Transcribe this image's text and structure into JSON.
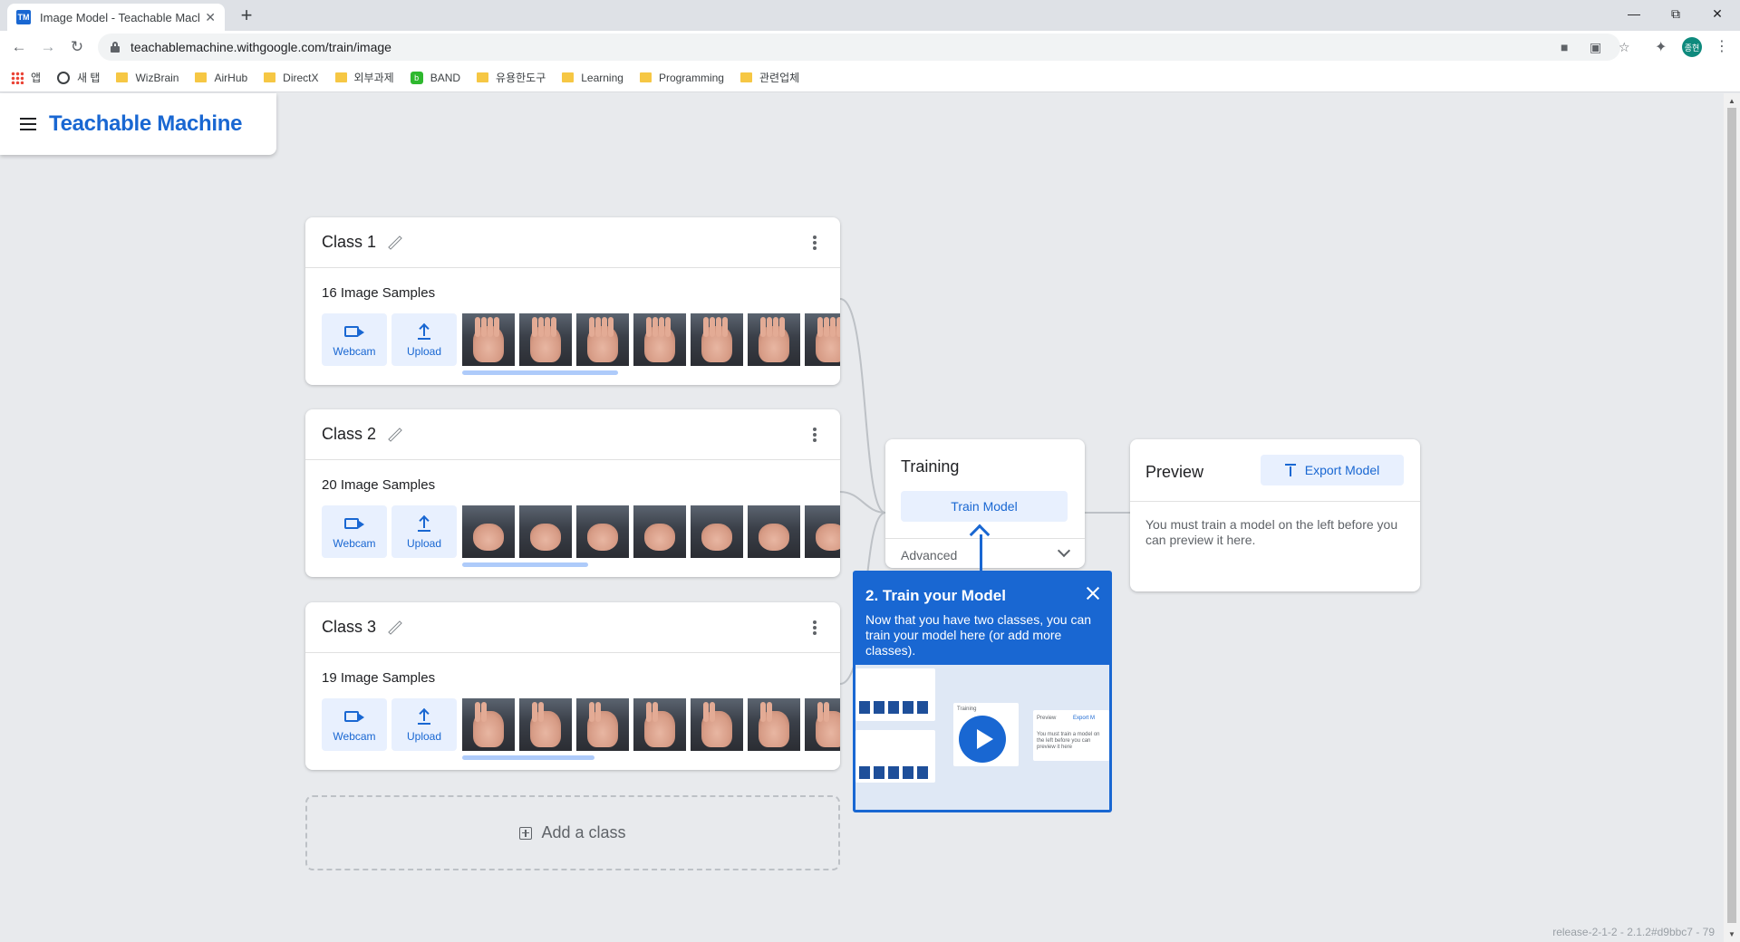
{
  "browser": {
    "tab_title": "Image Model - Teachable Mach",
    "favicon_text": "TM",
    "url": "teachablemachine.withgoogle.com/train/image",
    "profile_initials": "종현",
    "bookmarks": [
      {
        "label": "앱",
        "icon": "apps-icon"
      },
      {
        "label": "새 탭",
        "icon": "globe-icon"
      },
      {
        "label": "WizBrain",
        "icon": "folder-icon"
      },
      {
        "label": "AirHub",
        "icon": "folder-icon"
      },
      {
        "label": "DirectX",
        "icon": "folder-icon"
      },
      {
        "label": "외부과제",
        "icon": "folder-icon"
      },
      {
        "label": "BAND",
        "icon": "band-icon"
      },
      {
        "label": "유용한도구",
        "icon": "folder-icon"
      },
      {
        "label": "Learning",
        "icon": "folder-icon"
      },
      {
        "label": "Programming",
        "icon": "folder-icon"
      },
      {
        "label": "관련업체",
        "icon": "folder-icon"
      }
    ]
  },
  "app": {
    "brand": "Teachable Machine",
    "accent": "#1967d2",
    "light_accent": "#e8f0fe"
  },
  "classes": [
    {
      "name": "Class 1",
      "samples": "16 Image Samples",
      "webcam": "Webcam",
      "upload": "Upload",
      "thumb_type": "open"
    },
    {
      "name": "Class 2",
      "samples": "20 Image Samples",
      "webcam": "Webcam",
      "upload": "Upload",
      "thumb_type": "fist"
    },
    {
      "name": "Class 3",
      "samples": "19 Image Samples",
      "webcam": "Webcam",
      "upload": "Upload",
      "thumb_type": "v"
    }
  ],
  "add_class": "Add a class",
  "training": {
    "title": "Training",
    "train_button": "Train Model",
    "advanced": "Advanced"
  },
  "preview": {
    "title": "Preview",
    "export_button": "Export Model",
    "message": "You must train a model on the left before you can preview it here."
  },
  "tooltip": {
    "title": "2. Train your Model",
    "body": "Now that you have two classes, you can train your model here (or add more classes).",
    "video": {
      "training_label": "Training",
      "preview_label": "Preview",
      "export_label": "Export M",
      "preview_msg": "You must train a model on the left before you can preview it here"
    }
  },
  "release": "release-2-1-2 - 2.1.2#d9bbc7 - 79"
}
